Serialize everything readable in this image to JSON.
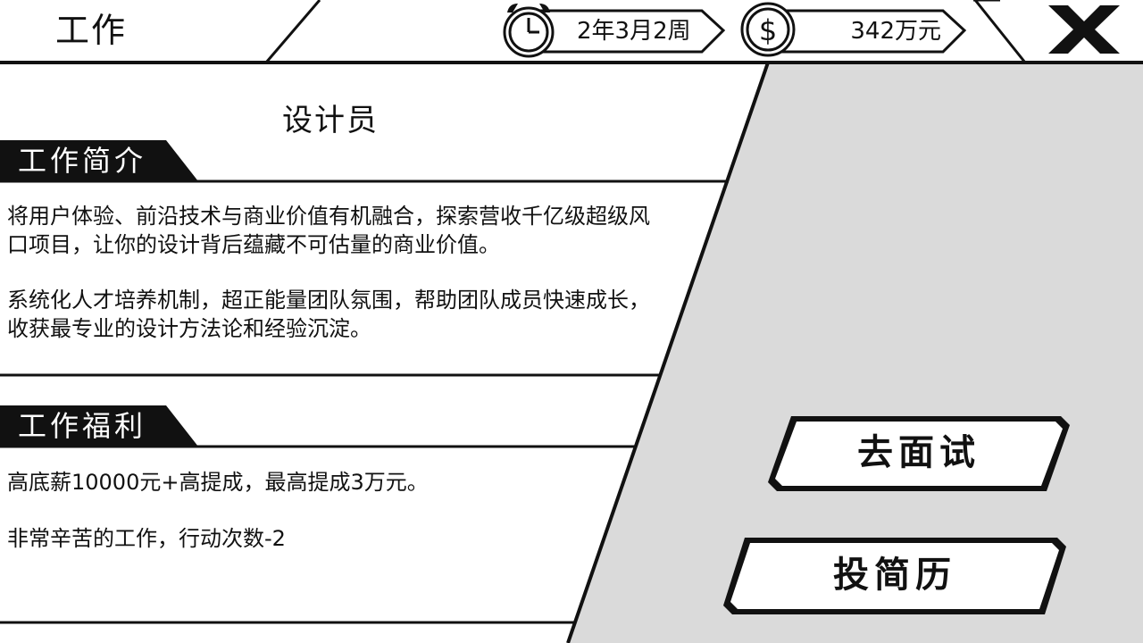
{
  "header": {
    "title": "工作",
    "date": "2年3月2周",
    "money": "342万元"
  },
  "job": {
    "name": "设计员",
    "intro_heading": "工作简介",
    "intro_paragraphs": [
      "将用户体验、前沿技术与商业价值有机融合，探索营收千亿级超级风口项目，让你的设计背后蕴藏不可估量的商业价值。",
      "系统化人才培养机制，超正能量团队氛围，帮助团队成员快速成长，收获最专业的设计方法论和经验沉淀。"
    ],
    "benefits_heading": "工作福利",
    "benefits_paragraphs": [
      "高底薪10000元+高提成，最高提成3万元。",
      "非常辛苦的工作，行动次数-2"
    ]
  },
  "actions": {
    "interview": "去面试",
    "resume": "投简历"
  },
  "colors": {
    "panel_gray": "#dadada",
    "ink": "#111111",
    "paper": "#ffffff"
  },
  "icons": {
    "clock": "alarm-clock-icon",
    "coin": "dollar-coin-icon",
    "close": "close-x-icon"
  }
}
